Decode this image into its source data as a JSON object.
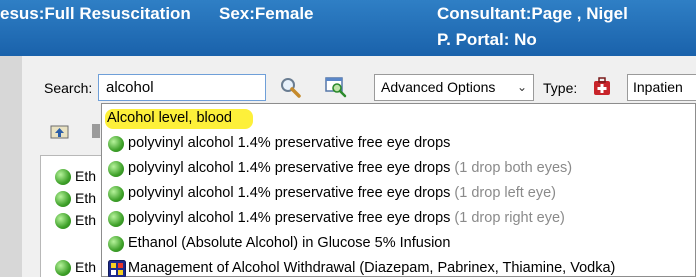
{
  "banner": {
    "patient_status": "esus:Full Resuscitation",
    "sex": "Sex:Female",
    "consultant": "Consultant:Page , Nigel",
    "portal": "P. Portal: No",
    "color": "#1a62ab"
  },
  "search": {
    "label": "Search:",
    "value": "alcohol"
  },
  "advanced_options": {
    "selected": "Advanced Options"
  },
  "type": {
    "label": "Type:",
    "selected": "Inpatien"
  },
  "results": [
    {
      "label": "Eth"
    },
    {
      "label": "Eth"
    },
    {
      "label": "Eth"
    },
    {
      "label": "Eth"
    }
  ],
  "suggestions": [
    {
      "text": "Alcohol level, blood",
      "hint": "",
      "icon": "highlight"
    },
    {
      "text": "polyvinyl alcohol 1.4% preservative free eye drops",
      "hint": "",
      "icon": "green-dot-icon"
    },
    {
      "text": "polyvinyl alcohol 1.4% preservative free eye drops",
      "hint": " (1 drop both eyes)",
      "icon": "green-dot-icon"
    },
    {
      "text": "polyvinyl alcohol 1.4% preservative free eye drops",
      "hint": " (1 drop left eye)",
      "icon": "green-dot-icon"
    },
    {
      "text": "polyvinyl alcohol 1.4% preservative free eye drops",
      "hint": " (1 drop right eye)",
      "icon": "green-dot-icon"
    },
    {
      "text": "Ethanol (Absolute Alcohol) in Glucose 5% Infusion",
      "hint": "",
      "icon": "green-dot-icon"
    },
    {
      "text": "Management of Alcohol Withdrawal (Diazepam, Pabrinex, Thiamine, Vodka)",
      "hint": "",
      "icon": "care-pathway-icon"
    }
  ],
  "colors": {
    "highlight": "#fdf03a",
    "hint_text": "#8a8a8a",
    "order_green": "#3fa12a"
  }
}
